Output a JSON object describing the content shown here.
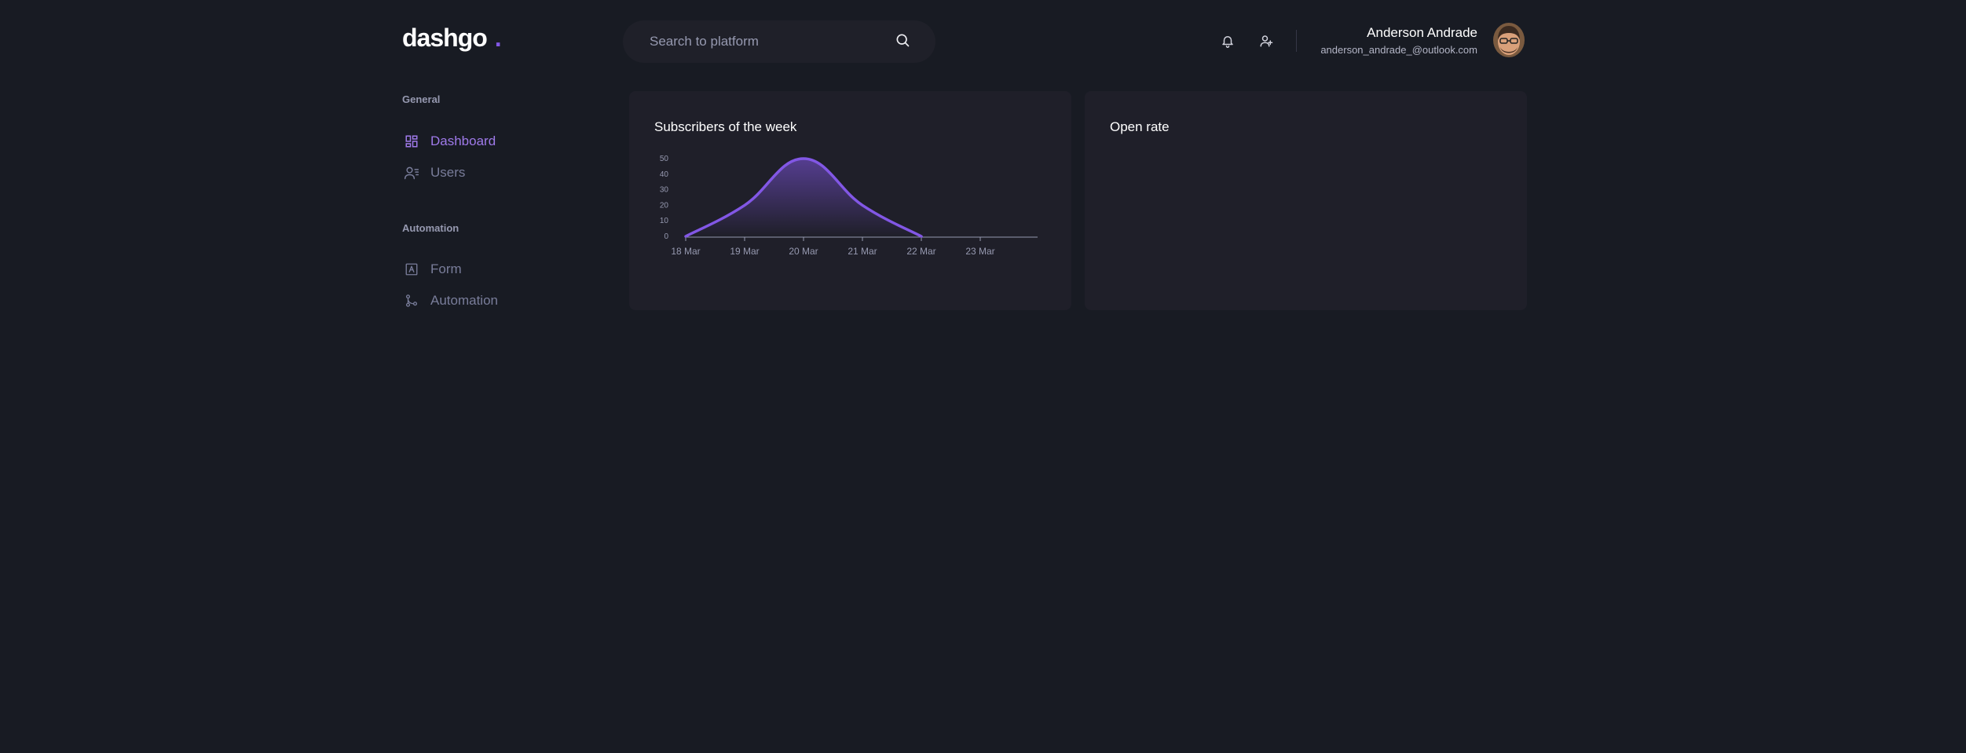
{
  "header": {
    "logo_text": "dashgo",
    "logo_dot": ".",
    "search_placeholder": "Search to platform",
    "icons": [
      "search-icon",
      "bell-icon",
      "user-add-icon"
    ],
    "profile": {
      "name": "Anderson Andrade",
      "email": "anderson_andrade_@outlook.com"
    }
  },
  "sidebar": {
    "sections": [
      {
        "title": "General",
        "items": [
          {
            "label": "Dashboard",
            "icon": "dashboard-icon",
            "active": true
          },
          {
            "label": "Users",
            "icon": "users-icon",
            "active": false
          }
        ]
      },
      {
        "title": "Automation",
        "items": [
          {
            "label": "Form",
            "icon": "form-icon",
            "active": false
          },
          {
            "label": "Automation",
            "icon": "git-merge-icon",
            "active": false
          }
        ]
      }
    ]
  },
  "cards": [
    {
      "title": "Subscribers of the week"
    },
    {
      "title": "Open rate"
    }
  ],
  "colors": {
    "background": "#181b23",
    "card": "#1f1f29",
    "accent": "#8257e5",
    "active_nav": "#9f7aea",
    "muted": "#797d9a"
  },
  "chart_data": {
    "type": "area",
    "title": "Subscribers of the week",
    "x": [
      "18 Mar",
      "19 Mar",
      "20 Mar",
      "21 Mar",
      "22 Mar",
      "23 Mar"
    ],
    "series": [
      {
        "values": [
          0,
          20,
          50,
          20,
          0
        ]
      }
    ],
    "y_ticks": [
      0,
      10,
      20,
      30,
      40,
      50
    ],
    "ylim": [
      0,
      50
    ],
    "grid": false
  }
}
